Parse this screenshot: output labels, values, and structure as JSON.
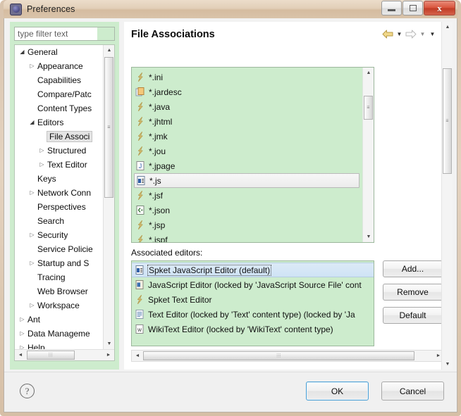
{
  "window": {
    "title": "Preferences",
    "icon": "eclipse-preferences-gear-icon",
    "minimize_label": "",
    "maximize_label": "",
    "close_label": "x"
  },
  "sidebar": {
    "filter": {
      "placeholder": "type filter text",
      "value": ""
    },
    "tree": [
      {
        "label": "General",
        "indent": 0,
        "twisty": "open"
      },
      {
        "label": "Appearance",
        "indent": 1,
        "twisty": "closed"
      },
      {
        "label": "Capabilities",
        "indent": 1,
        "twisty": "none"
      },
      {
        "label": "Compare/Patc",
        "indent": 1,
        "twisty": "none"
      },
      {
        "label": "Content Types",
        "indent": 1,
        "twisty": "none"
      },
      {
        "label": "Editors",
        "indent": 1,
        "twisty": "open"
      },
      {
        "label": "File Associ",
        "indent": 2,
        "twisty": "none",
        "selected": true
      },
      {
        "label": "Structured",
        "indent": 2,
        "twisty": "closed"
      },
      {
        "label": "Text Editor",
        "indent": 2,
        "twisty": "closed"
      },
      {
        "label": "Keys",
        "indent": 1,
        "twisty": "none"
      },
      {
        "label": "Network Conn",
        "indent": 1,
        "twisty": "closed"
      },
      {
        "label": "Perspectives",
        "indent": 1,
        "twisty": "none"
      },
      {
        "label": "Search",
        "indent": 1,
        "twisty": "none"
      },
      {
        "label": "Security",
        "indent": 1,
        "twisty": "closed"
      },
      {
        "label": "Service Policie",
        "indent": 1,
        "twisty": "none"
      },
      {
        "label": "Startup and S",
        "indent": 1,
        "twisty": "closed"
      },
      {
        "label": "Tracing",
        "indent": 1,
        "twisty": "none"
      },
      {
        "label": "Web Browser",
        "indent": 1,
        "twisty": "none"
      },
      {
        "label": "Workspace",
        "indent": 1,
        "twisty": "closed"
      },
      {
        "label": "Ant",
        "indent": 0,
        "twisty": "closed"
      },
      {
        "label": "Data Manageme",
        "indent": 0,
        "twisty": "closed"
      },
      {
        "label": "Help",
        "indent": 0,
        "twisty": "closed"
      }
    ]
  },
  "page": {
    "title": "File Associations",
    "nav": {
      "back_icon": "back-arrow-icon",
      "back_menu_icon": "chevron-down-icon",
      "forward_icon": "forward-arrow-icon",
      "forward_menu_icon": "chevron-down-icon",
      "view_menu_icon": "chevron-down-icon"
    },
    "file_types": [
      {
        "label": "*.ini",
        "icon": "generic-yellow-file-icon"
      },
      {
        "label": "*.jardesc",
        "icon": "jar-descriptor-icon"
      },
      {
        "label": "*.java",
        "icon": "generic-yellow-file-icon"
      },
      {
        "label": "*.jhtml",
        "icon": "generic-yellow-file-icon"
      },
      {
        "label": "*.jmk",
        "icon": "generic-yellow-file-icon"
      },
      {
        "label": "*.jou",
        "icon": "generic-yellow-file-icon"
      },
      {
        "label": "*.jpage",
        "icon": "jpage-file-icon"
      },
      {
        "label": "*.js",
        "icon": "javascript-file-icon",
        "selected": true
      },
      {
        "label": "*.jsf",
        "icon": "generic-yellow-file-icon"
      },
      {
        "label": "*.json",
        "icon": "json-file-icon"
      },
      {
        "label": "*.jsp",
        "icon": "generic-yellow-file-icon"
      },
      {
        "label": "*.jspf",
        "icon": "generic-yellow-file-icon"
      }
    ],
    "associated_editors_label": "Associated editors:",
    "editors": [
      {
        "label": "Spket JavaScript Editor (default)",
        "icon": "javascript-editor-icon",
        "selected": true
      },
      {
        "label": "JavaScript Editor (locked by 'JavaScript Source File' cont",
        "icon": "javascript-source-editor-icon"
      },
      {
        "label": "Spket Text Editor",
        "icon": "generic-yellow-file-icon"
      },
      {
        "label": "Text Editor (locked by 'Text' content type) (locked by 'Ja",
        "icon": "text-editor-icon"
      },
      {
        "label": "WikiText Editor (locked by 'WikiText' content type)",
        "icon": "wikitext-editor-icon"
      }
    ],
    "buttons": {
      "add": "Add...",
      "remove": "Remove",
      "default": "Default"
    }
  },
  "footer": {
    "help_icon": "help-question-icon",
    "help_glyph": "?",
    "ok": "OK",
    "cancel": "Cancel"
  },
  "colors": {
    "list_background": "#cdeccd",
    "window_frame": "#d8c3ad",
    "selection_blue": "#cfe3f5",
    "focus_border": "#4a9fd4"
  }
}
